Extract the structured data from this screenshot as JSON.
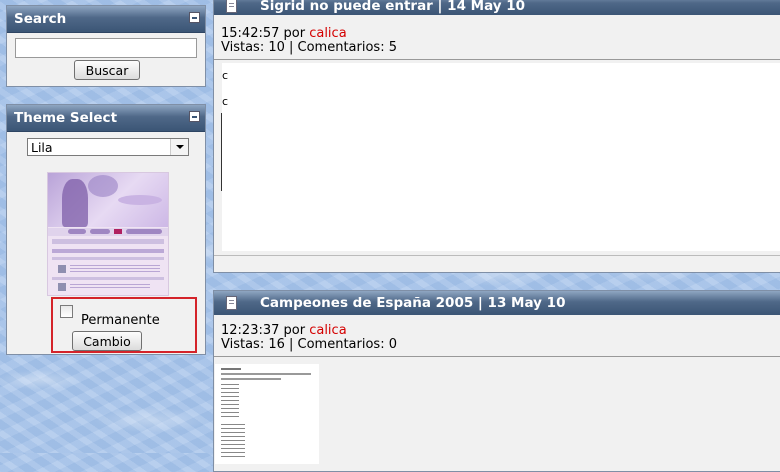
{
  "search": {
    "title": "Search",
    "input_value": "",
    "button_label": "Buscar"
  },
  "theme": {
    "title": "Theme Select",
    "selected": "Lila",
    "permanent_label": "Permanente",
    "change_label": "Cambio",
    "highlight_color": "#d4232a"
  },
  "posts": [
    {
      "title": "Sigrid no puede entrar | 14 May 10",
      "time": "15:42:57 por ",
      "author": "calica",
      "stats": "Vistas: 10 | Comentarios: 5"
    },
    {
      "title": "Campeones de España 2005 | 13 May 10",
      "time": "12:23:37 por ",
      "author": "calica",
      "stats": "Vistas: 16 | Comentarios: 0"
    }
  ],
  "colors": {
    "header": "#4f6888",
    "author": "#d40000",
    "panel": "#f1f1f1"
  }
}
